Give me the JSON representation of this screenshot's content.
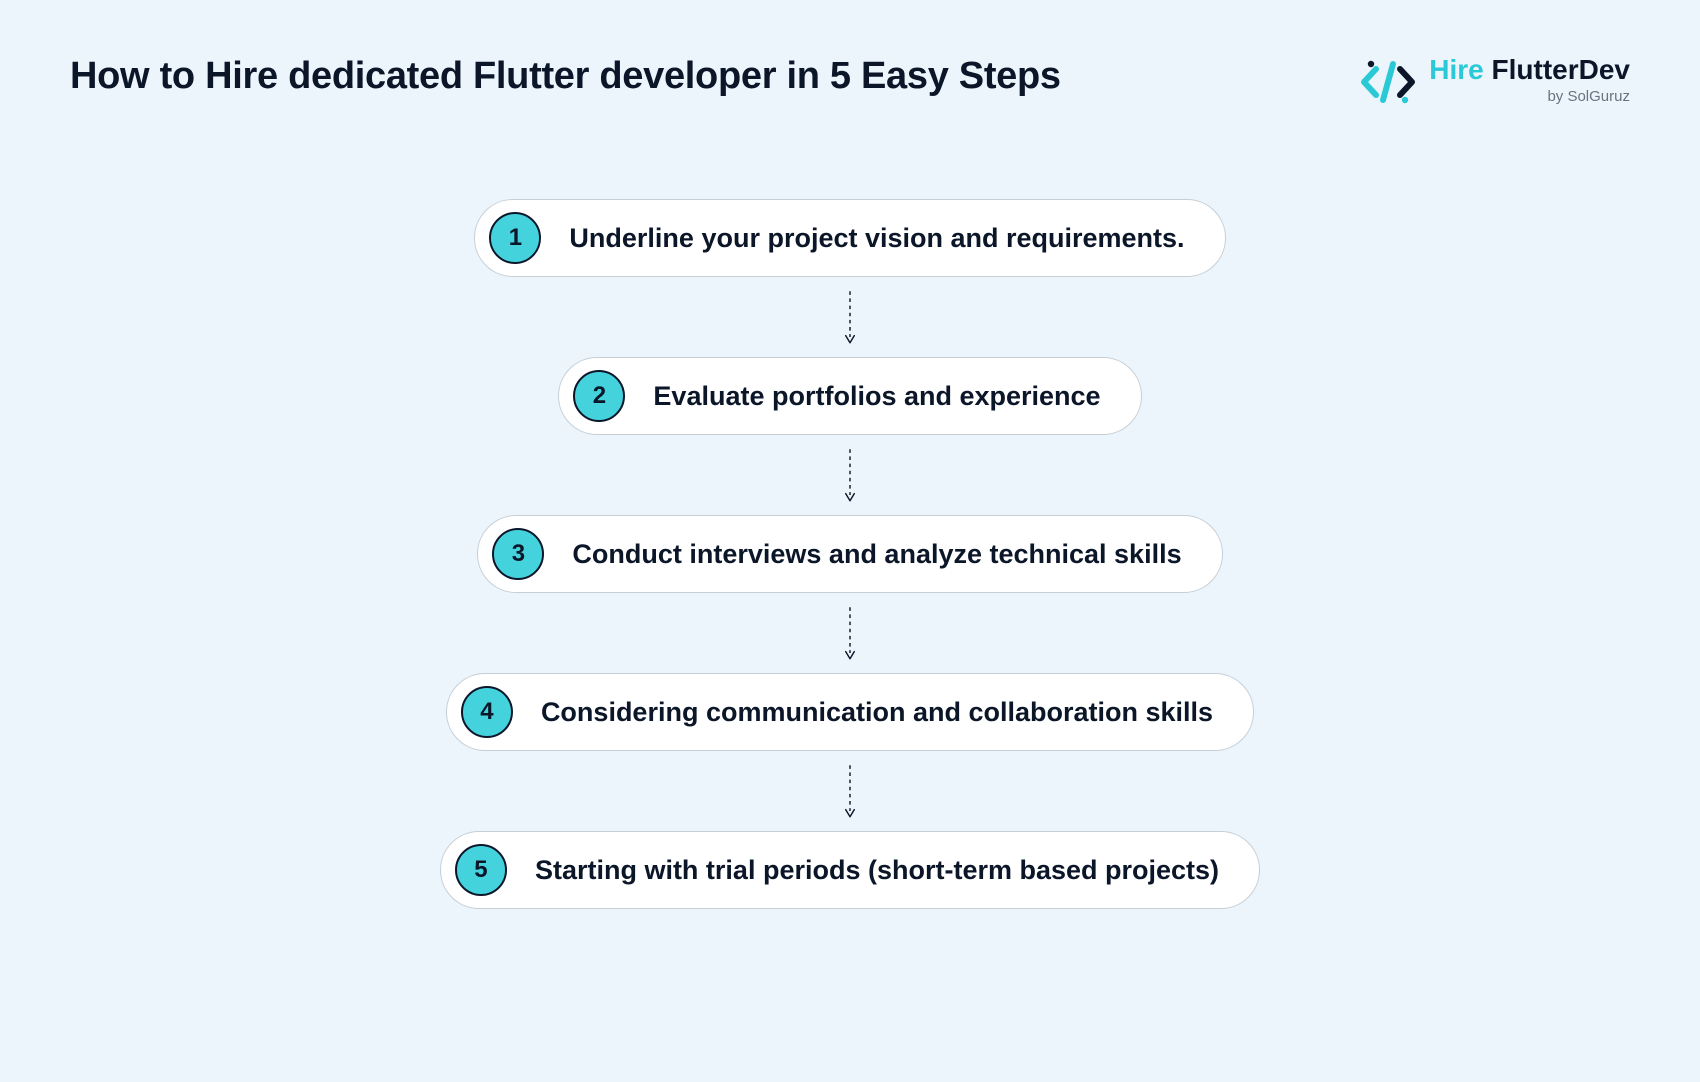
{
  "header": {
    "title": "How to Hire dedicated Flutter developer in 5 Easy Steps"
  },
  "logo": {
    "text_accent": "Hire",
    "text_dark": "FlutterDev",
    "subtext": "by SolGuruz"
  },
  "steps": [
    {
      "num": "1",
      "label": "Underline your project vision and requirements."
    },
    {
      "num": "2",
      "label": "Evaluate portfolios and experience"
    },
    {
      "num": "3",
      "label": "Conduct interviews and analyze technical skills"
    },
    {
      "num": "4",
      "label": "Considering communication and collaboration skills"
    },
    {
      "num": "5",
      "label": "Starting with trial periods (short-term based projects)"
    }
  ],
  "colors": {
    "background": "#ECF5FC",
    "accent": "#44D3DD",
    "text": "#0C1629",
    "border": "#C6CED6"
  }
}
